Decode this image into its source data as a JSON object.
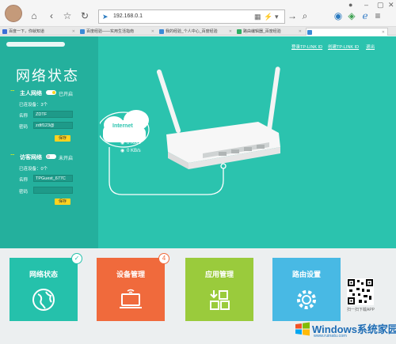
{
  "browser": {
    "address": "192.168.0.1",
    "tabs": [
      {
        "label": "百度一下，你就知道",
        "favicon_color": "#3b6fd6"
      },
      {
        "label": "百度经验——实用生活指南",
        "favicon_color": "#3b8ad6"
      },
      {
        "label": "我的经验_个人中心_百度经验",
        "favicon_color": "#3b8ad6"
      },
      {
        "label": "路由编辑器_百度经验",
        "favicon_color": "#2fae63"
      },
      {
        "label": "",
        "favicon_color": "#3b8ad6"
      }
    ]
  },
  "sidebar": {
    "title": "网络状态",
    "main_network": {
      "title": "主人网络",
      "state": "已开启",
      "devices": "已连设备：3个",
      "name_label": "名称",
      "name_value": "ZDTF",
      "pwd_label": "密码",
      "pwd_value": "zdtf123@",
      "save_label": "保存"
    },
    "guest_network": {
      "title": "访客网络",
      "state": "未开启",
      "devices": "已连设备：0个",
      "name_label": "名称",
      "name_value": "TPGuest_677C",
      "pwd_label": "密码",
      "pwd_value": "",
      "save_label": "保存"
    }
  },
  "header_links": {
    "login": "登录TP-LINK ID",
    "create": "创建TP-LINK ID",
    "exit": "退出"
  },
  "diagram": {
    "cloud_label": "Internet",
    "up_rate": "0 KB/s",
    "down_rate": "0 KB/s"
  },
  "cards": [
    {
      "title": "网络状态",
      "color": "#25c1ab",
      "badge": "✓",
      "icon": "globe-icon"
    },
    {
      "title": "设备管理",
      "color": "#f06a3c",
      "badge": "4",
      "icon": "laptop-icon"
    },
    {
      "title": "应用管理",
      "color": "#9acb3c",
      "badge": "",
      "icon": "apps-icon"
    },
    {
      "title": "路由设置",
      "color": "#48b9e4",
      "badge": "",
      "icon": "gear-icon"
    }
  ],
  "qr_caption": "扫一扫下载APP",
  "watermark": {
    "title": "Windows系统家园",
    "sub": "www.ruinatu.com"
  }
}
